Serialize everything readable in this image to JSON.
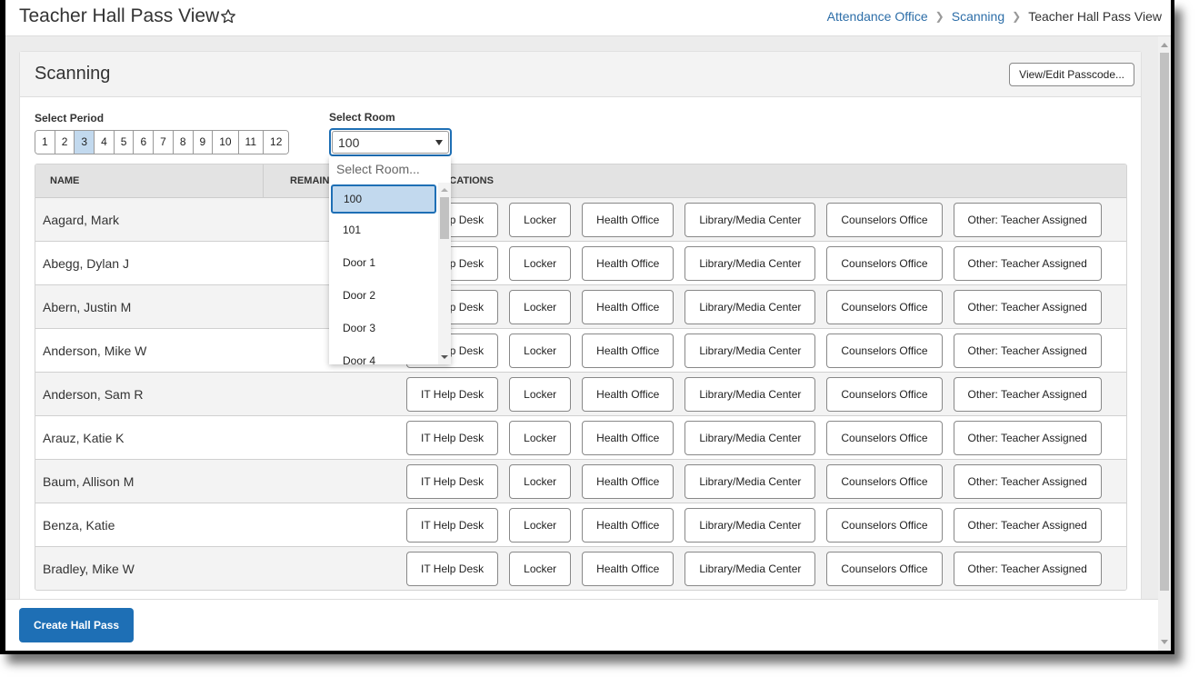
{
  "header": {
    "title": "Teacher Hall Pass View",
    "favorite_icon": "star-outline-icon",
    "breadcrumb": [
      {
        "label": "Attendance Office",
        "link": true
      },
      {
        "label": "Scanning",
        "link": true
      },
      {
        "label": "Teacher Hall Pass View",
        "link": false
      }
    ],
    "breadcrumb_separator": ">"
  },
  "card": {
    "title": "Scanning",
    "passcode_button": "View/Edit Passcode..."
  },
  "period": {
    "label": "Select Period",
    "options": [
      "1",
      "2",
      "3",
      "4",
      "5",
      "6",
      "7",
      "8",
      "9",
      "10",
      "11",
      "12"
    ],
    "selected": "3"
  },
  "room": {
    "label": "Select Room",
    "value": "100",
    "placeholder": "Select Room...",
    "options": [
      "100",
      "101",
      "Door 1",
      "Door 2",
      "Door 3",
      "Door 4"
    ],
    "selected": "100"
  },
  "table": {
    "columns": [
      "NAME",
      "REMAINING",
      "LOCATIONS"
    ],
    "locations": [
      "IT Help Desk",
      "Locker",
      "Health Office",
      "Library/Media Center",
      "Counselors Office",
      "Other: Teacher Assigned"
    ],
    "students": [
      "Aagard, Mark",
      "Abegg, Dylan J",
      "Abern, Justin M",
      "Anderson, Mike W",
      "Anderson, Sam R",
      "Arauz, Katie K",
      "Baum, Allison M",
      "Benza, Katie",
      "Bradley, Mike W"
    ]
  },
  "footer": {
    "create_button": "Create Hall Pass"
  },
  "colors": {
    "accent": "#1e6fb5",
    "selected_bg": "#c2d9ee",
    "link": "#2d6ea8"
  }
}
